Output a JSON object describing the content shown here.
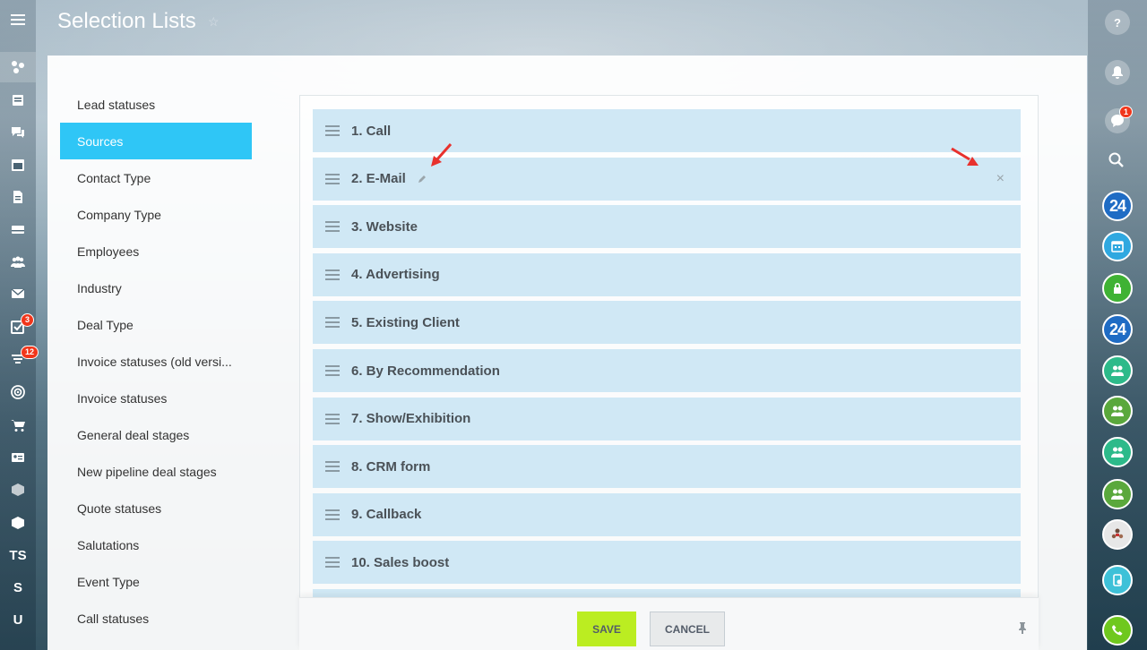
{
  "header": {
    "title": "Selection Lists"
  },
  "left_nav": {
    "items": [
      {
        "name": "sidebar-item-activity-stream",
        "icon": "molecule-icon",
        "text": ""
      },
      {
        "name": "sidebar-item-feed",
        "icon": "list-icon",
        "text": ""
      },
      {
        "name": "sidebar-item-chats",
        "icon": "chat-icon",
        "text": ""
      },
      {
        "name": "sidebar-item-calendar",
        "icon": "calendar-icon",
        "text": ""
      },
      {
        "name": "sidebar-item-documents",
        "icon": "document-icon",
        "text": ""
      },
      {
        "name": "sidebar-item-drive",
        "icon": "drive-icon",
        "text": ""
      },
      {
        "name": "sidebar-item-groups",
        "icon": "people-icon",
        "text": ""
      },
      {
        "name": "sidebar-item-mail",
        "icon": "mail-icon",
        "text": ""
      },
      {
        "name": "sidebar-item-tasks",
        "icon": "checkbox-icon",
        "text": "",
        "badge": "3"
      },
      {
        "name": "sidebar-item-crm",
        "icon": "funnel-icon",
        "text": "",
        "badge": "12"
      },
      {
        "name": "sidebar-item-marketing",
        "icon": "target-icon",
        "text": ""
      },
      {
        "name": "sidebar-item-store",
        "icon": "cart-icon",
        "text": ""
      },
      {
        "name": "sidebar-item-contacts",
        "icon": "id-card-icon",
        "text": ""
      },
      {
        "name": "sidebar-item-inventory",
        "icon": "box-icon",
        "text": ""
      },
      {
        "name": "sidebar-item-apps",
        "icon": "cube-icon",
        "text": ""
      },
      {
        "name": "sidebar-item-ts",
        "icon": "",
        "text": "TS"
      },
      {
        "name": "sidebar-item-s",
        "icon": "",
        "text": "S"
      },
      {
        "name": "sidebar-item-u",
        "icon": "",
        "text": "U"
      }
    ]
  },
  "right_bar": {
    "help_icon": "question-icon",
    "notifications_icon": "bell-icon",
    "messages_badge": "1",
    "open_lines_text": "24",
    "network_text": "24"
  },
  "menu": {
    "items": [
      "Lead statuses",
      "Sources",
      "Contact Type",
      "Company Type",
      "Employees",
      "Industry",
      "Deal Type",
      "Invoice statuses (old versi...",
      "Invoice statuses",
      "General deal stages",
      "New pipeline deal stages",
      "Quote statuses",
      "Salutations",
      "Event Type",
      "Call statuses"
    ],
    "active_index": 1
  },
  "list": {
    "rows": [
      "1. Call",
      "2. E-Mail",
      "3. Website",
      "4. Advertising",
      "5. Existing Client",
      "6. By Recommendation",
      "7. Show/Exhibition",
      "8. CRM form",
      "9. Callback",
      "10. Sales boost"
    ],
    "hovered_row": 1,
    "row_color": "#d0e8f5",
    "annotation_color": "#e8312d"
  },
  "footer": {
    "save_label": "SAVE",
    "cancel_label": "CANCEL",
    "save_color": "#bbed21"
  }
}
